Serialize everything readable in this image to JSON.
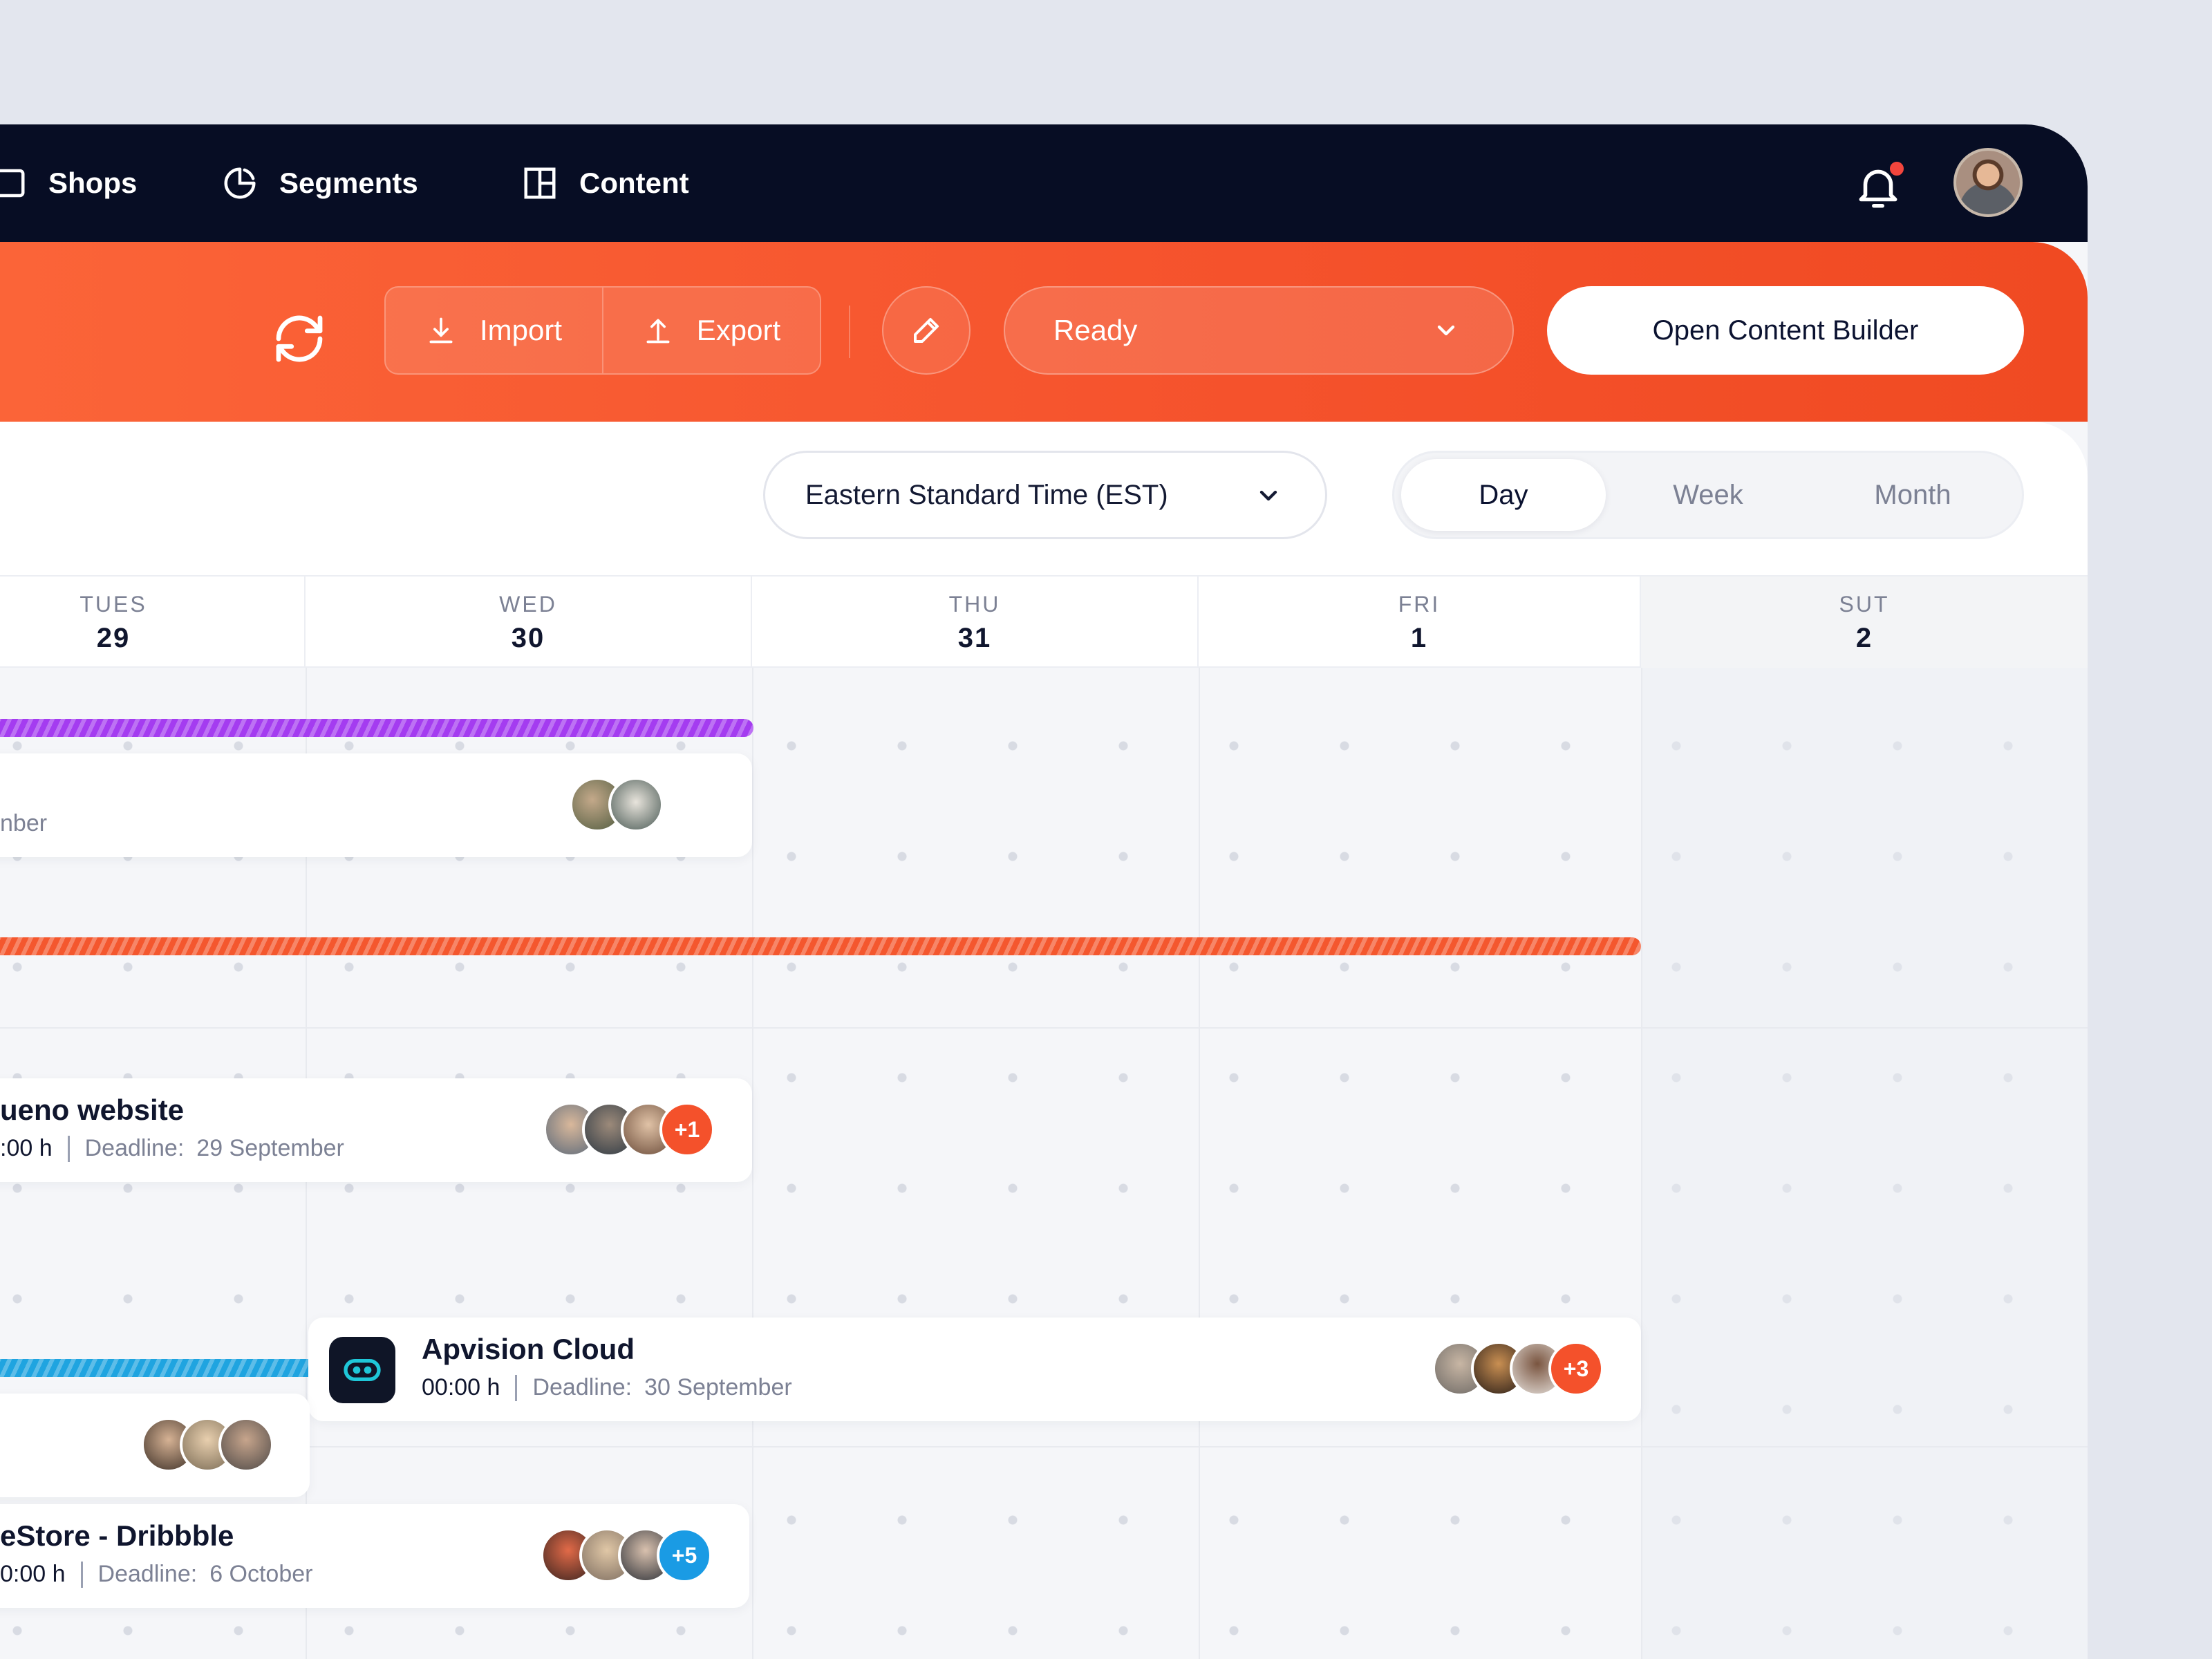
{
  "colors": {
    "nav_bg": "#070d24",
    "accent_orange": "#f5522c",
    "stripe_purple": "#a43cf0",
    "stripe_orange": "#f4572e",
    "stripe_blue": "#1fa4e0",
    "badge_orange": "#f4512b",
    "badge_blue": "#1a9be4"
  },
  "nav": {
    "items": [
      {
        "label": "Shops",
        "icon": "shop-icon"
      },
      {
        "label": "Segments",
        "icon": "pie-chart-icon"
      },
      {
        "label": "Content",
        "icon": "layout-icon"
      }
    ],
    "notification_icon": "bell-icon",
    "has_unread": true
  },
  "toolbar": {
    "sync_icon": "refresh-icon",
    "import_label": "Import",
    "export_label": "Export",
    "edit_icon": "pencil-icon",
    "status_value": "Ready",
    "builder_label": "Open Content Builder"
  },
  "options": {
    "timezone": "Eastern Standard Time (EST)",
    "views": [
      "Day",
      "Week",
      "Month"
    ],
    "active_view": "Day"
  },
  "calendar": {
    "days": [
      {
        "name": "TUES",
        "num": "29"
      },
      {
        "name": "WED",
        "num": "30"
      },
      {
        "name": "THU",
        "num": "31"
      },
      {
        "name": "FRI",
        "num": "1"
      },
      {
        "name": "SUT",
        "num": "2"
      }
    ],
    "events": [
      {
        "title": "",
        "time": "",
        "deadline_label": "",
        "deadline": "nber",
        "more": ""
      },
      {
        "title": "ueno website",
        "time": ":00 h",
        "deadline_label": "Deadline:",
        "deadline": "29 September",
        "more": "+1"
      },
      {
        "title": "Apvision Cloud",
        "time": "00:00 h",
        "deadline_label": "Deadline:",
        "deadline": "30 September",
        "more": "+3"
      },
      {
        "title": "",
        "time": "",
        "deadline_label": "",
        "deadline": "",
        "more": ""
      },
      {
        "title": "eStore - Dribbble",
        "time": "0:00 h",
        "deadline_label": "Deadline:",
        "deadline": "6 October",
        "more": "+5"
      }
    ]
  }
}
